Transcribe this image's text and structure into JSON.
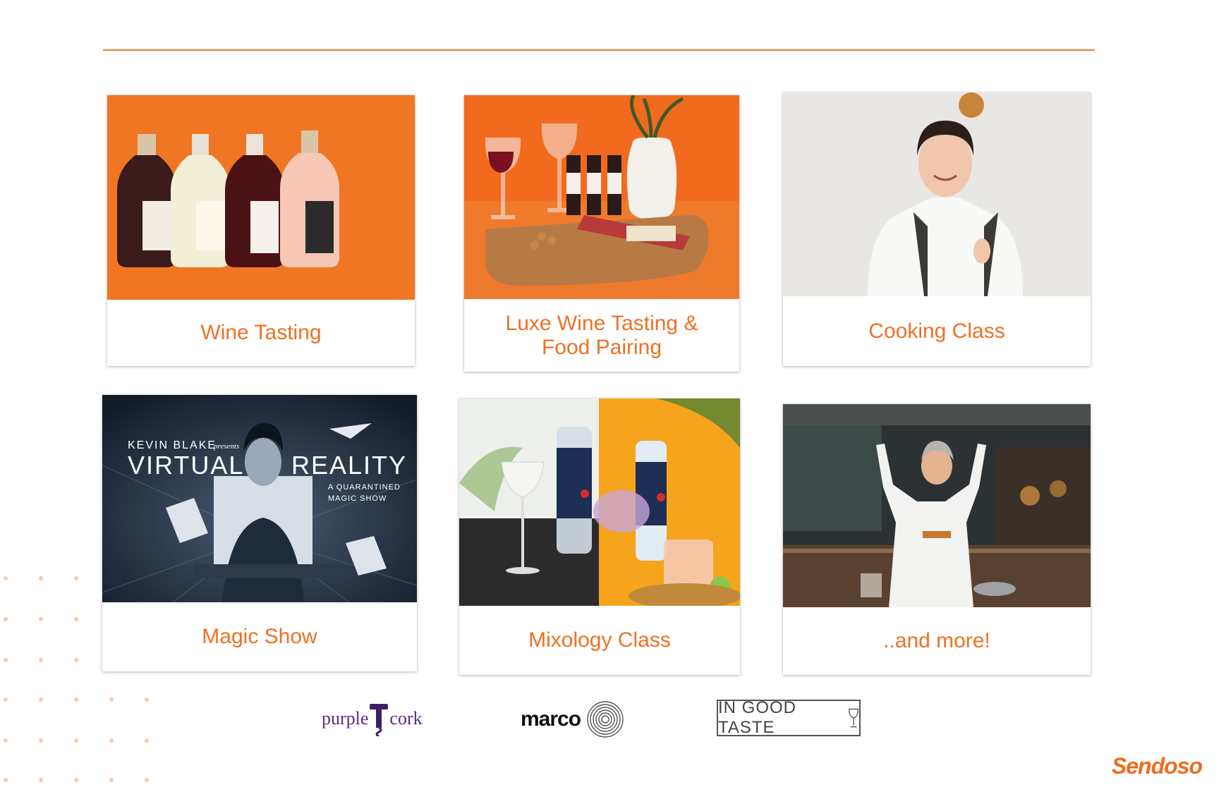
{
  "cards": [
    {
      "caption": "Wine Tasting",
      "image": "wine-bottles-photo"
    },
    {
      "caption": "Luxe Wine Tasting & Food Pairing",
      "caption_line1": "Luxe Wine Tasting &",
      "caption_line2": "Food Pairing",
      "image": "wine-charcuterie-photo"
    },
    {
      "caption": "Cooking Class",
      "image": "chef-photo"
    },
    {
      "caption": "Magic Show",
      "image": "magic-show-poster",
      "poster": {
        "presenter": "KEVIN BLAKE",
        "presents": "presents",
        "word1": "VIRTUAL",
        "word2": "REALITY",
        "tagline1": "A QUARANTINED",
        "tagline2": "MAGIC SHOW"
      }
    },
    {
      "caption": "Mixology Class",
      "image": "cocktails-photo"
    },
    {
      "caption": "..and more!",
      "image": "chef-kitchen-photo"
    }
  ],
  "partners": [
    {
      "name": "purple cork",
      "part1": "purple",
      "part2": "cork"
    },
    {
      "name": "marco"
    },
    {
      "name": "IN GOOD TASTE"
    }
  ],
  "brand": "Sendoso",
  "colors": {
    "accent": "#ee7124",
    "rule": "#f07a2c"
  }
}
